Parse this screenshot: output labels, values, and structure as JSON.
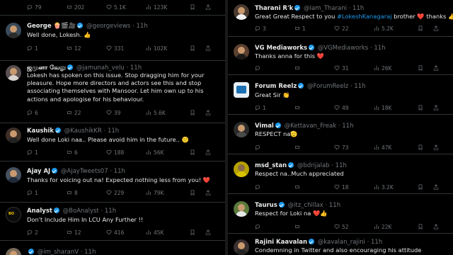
{
  "left": {
    "top_metrics": {
      "replies": "79",
      "reposts": "202",
      "likes": "5.1K",
      "views": "123K"
    },
    "tweets": [
      {
        "name": "George 🍿🎬🎥",
        "handle": "@georgeviews",
        "time": "· 11h",
        "text": "Well done, Lokesh. 👍",
        "replies": "1",
        "reposts": "12",
        "likes": "331",
        "views": "102K"
      },
      {
        "name": "ஜமுனா வேலு",
        "handle": "@jamunah_velu",
        "time": "· 11h",
        "text": "Lokesh has spoken on this issue. Stop dragging him for your pleasure. Hope more directors and actors see this and stop associating themselves with Mansoor. Let him own up to his actions and apologise for his behaviour.",
        "replies": "6",
        "reposts": "22",
        "likes": "39",
        "views": "5.6K"
      },
      {
        "name": "Kaushik",
        "handle": "@KaushikKR",
        "time": "· 11h",
        "text": "Well done Loki naa.. Please avoid him in the future.. 🙂",
        "replies": "1",
        "reposts": "6",
        "likes": "188",
        "views": "56K"
      },
      {
        "name": "Ajay AJ",
        "handle": "@AjayTweets07",
        "time": "· 11h",
        "text": "Thanks for voicing out na! Expected nothing less from you! ❤️",
        "replies": "1",
        "reposts": "8",
        "likes": "229",
        "views": "79K"
      },
      {
        "name": "Analyst",
        "handle": "@BoAnalyst",
        "time": "· 11h",
        "text": "Don't Include Him In LCU Any Further !!",
        "replies": "2",
        "reposts": "12",
        "likes": "416",
        "views": "45K"
      },
      {
        "name": "",
        "handle": "@im_sharanV",
        "time": "· 11h",
        "text": "",
        "replies": "",
        "reposts": "",
        "likes": "",
        "views": ""
      }
    ]
  },
  "right": {
    "tweets": [
      {
        "name": "Tharani R'k",
        "handle": "@Iam_Tharani",
        "time": "· 11h",
        "text_pre": "Great Great Respect to you ",
        "hashtag": "#LokeshKanagaraj",
        "text_post": " brother ❤️ thanks 👍",
        "replies": "3",
        "reposts": "1",
        "likes": "22",
        "views": "5.2K"
      },
      {
        "name": "VG Mediaworks",
        "handle": "@VGMediaworks",
        "time": "· 11h",
        "text": "Thanks anna for this ❤️",
        "replies": "",
        "reposts": "",
        "likes": "31",
        "views": "26K"
      },
      {
        "name": "Forum Reelz",
        "handle": "@ForumReelz",
        "time": "· 11h",
        "text": "Great Sir 👏",
        "replies": "1",
        "reposts": "",
        "likes": "49",
        "views": "18K"
      },
      {
        "name": "Vimal",
        "handle": "@Kettavan_Freak",
        "time": "· 11h",
        "text": "RESPECT na🫡",
        "replies": "",
        "reposts": "",
        "likes": "73",
        "views": "47K"
      },
      {
        "name": "msd_stan",
        "handle": "@bdrijalab",
        "time": "· 11h",
        "text": "Respect na..Much appreciated",
        "replies": "",
        "reposts": "",
        "likes": "18",
        "views": "3.2K"
      },
      {
        "name": "Taurus",
        "handle": "@itz_chillax",
        "time": "· 11h",
        "text": "Respect for Loki na ❤️👍",
        "replies": "",
        "reposts": "",
        "likes": "52",
        "views": "22K"
      },
      {
        "name": "Rajini Kaavalan",
        "handle": "@kavalan_rajini",
        "time": "· 11h",
        "text": "Condemning in Twitter and also encouraging his attitude",
        "replies": "",
        "reposts": "",
        "likes": "",
        "views": ""
      }
    ]
  },
  "colors": {
    "background": "#000000",
    "text": "#e7e9ea",
    "muted": "#71767b",
    "accent": "#1d9bf0",
    "heart": "#f91880",
    "border": "#2f3336"
  },
  "icons": [
    "reply-icon",
    "repost-icon",
    "like-icon",
    "views-icon",
    "bookmark-icon",
    "share-icon",
    "verified-icon"
  ]
}
